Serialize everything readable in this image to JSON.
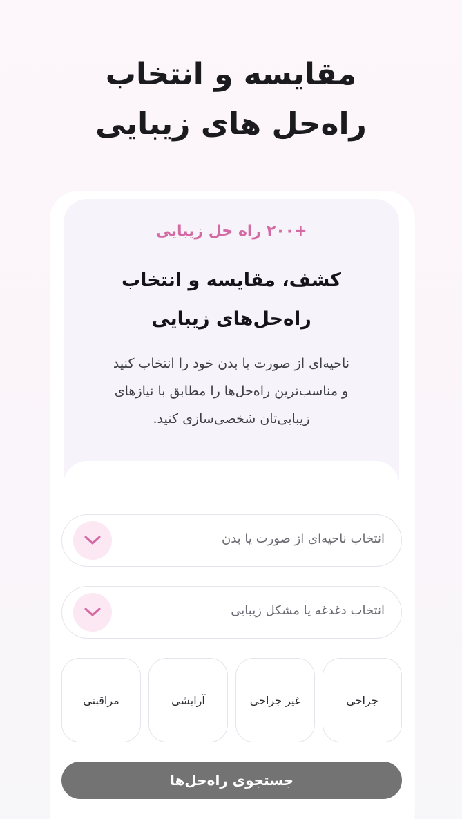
{
  "hero": {
    "title_line1": "مقایسه و انتخاب",
    "title_line2": "راه‌حل های زیبایی"
  },
  "card": {
    "badge": "+۲۰۰ راه حل زیبایی",
    "title_line1": "کشف، مقایسه و انتخاب",
    "title_line2": "راه‌حل‌های زیبایی",
    "description_line1": "ناحیه‌ای از صورت یا بدن خود را انتخاب کنید",
    "description_line2": "و مناسب‌ترین راه‌حل‌ها را مطابق با نیازهای",
    "description_line3": "زیبایی‌تان شخصی‌سازی کنید."
  },
  "form": {
    "area_select_label": "انتخاب ناحیه‌ای از صورت یا بدن",
    "concern_select_label": "انتخاب دغدغه یا مشکل زیبایی",
    "categories": [
      "جراحی",
      "غیر جراحی",
      "آرایشی",
      "مراقبتی"
    ],
    "search_button": "جستجوی راه‌حل‌ها"
  },
  "icons": {
    "area_select_icon": "chevron-down-icon",
    "concern_select_icon": "chevron-down-icon"
  },
  "colors": {
    "accent": "#d46aa3",
    "chevron_bg": "#fbe8f2",
    "search_button_bg": "#737373"
  }
}
